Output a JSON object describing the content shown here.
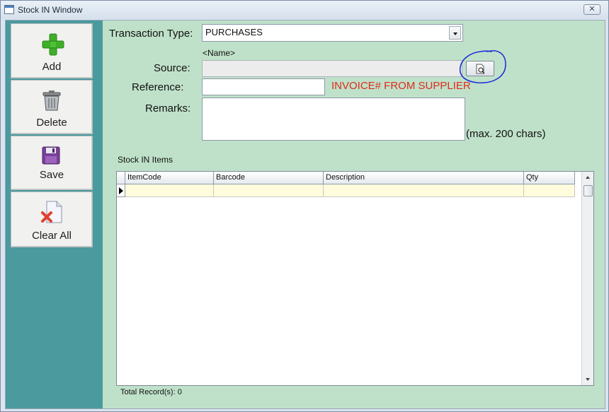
{
  "window": {
    "title": "Stock IN Window",
    "close_label": "✕"
  },
  "sidebar": {
    "add_label": "Add",
    "delete_label": "Delete",
    "save_label": "Save",
    "clear_label": "Clear All"
  },
  "form": {
    "transaction_type_label": "Transaction Type:",
    "transaction_type_value": "PURCHASES",
    "name_hint": "<Name>",
    "source_label": "Source:",
    "source_value": "",
    "reference_label": "Reference:",
    "reference_value": "",
    "reference_hint": "INVOICE# FROM SUPPLIER",
    "remarks_label": "Remarks:",
    "remarks_value": "",
    "remarks_hint": "(max. 200 chars)"
  },
  "grid": {
    "title": "Stock IN Items",
    "columns": [
      "ItemCode",
      "Barcode",
      "Description",
      "Qty"
    ],
    "rows": [],
    "total_label": "Total Record(s): 0"
  },
  "colors": {
    "client_bg": "#bfe1c9",
    "sidebar_bg": "#4a9a9e",
    "hint_red": "#e02a1c",
    "annotation_blue": "#1f2fd6",
    "new_row_bg": "#fffbdd"
  },
  "icons": {
    "add": "plus-icon",
    "delete": "trash-icon",
    "save": "floppy-disk-icon",
    "clear": "clear-document-icon",
    "lookup": "magnify-document-icon"
  }
}
